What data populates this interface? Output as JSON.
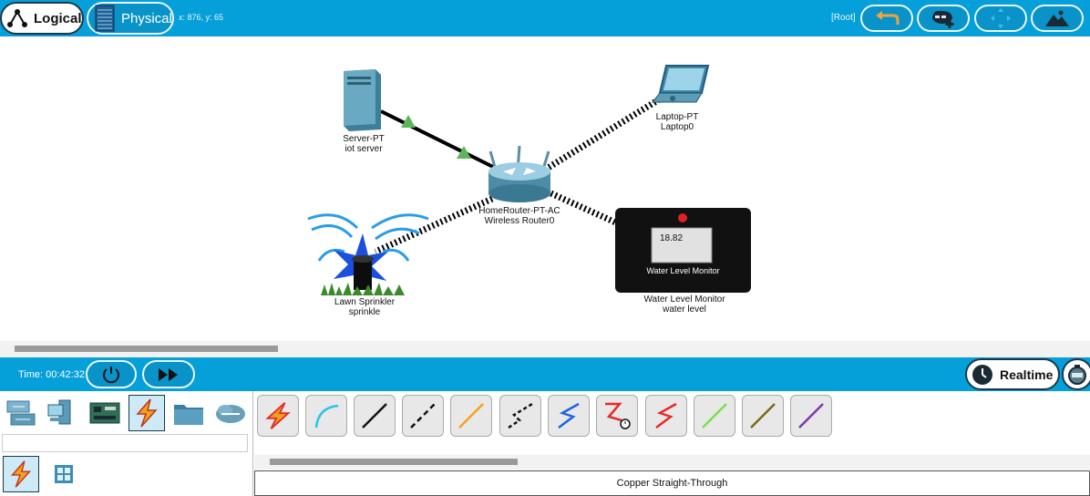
{
  "topbar": {
    "logical_label": "Logical",
    "physical_label": "Physical",
    "coords": "x: 876, y: 65",
    "root_label": "[Root]"
  },
  "devices": {
    "server": {
      "model": "Server-PT",
      "name": "iot server"
    },
    "laptop": {
      "model": "Laptop-PT",
      "name": "Laptop0"
    },
    "router": {
      "model": "HomeRouter-PT-AC",
      "name": "Wireless Router0"
    },
    "sprinkler": {
      "model": "Lawn Sprinkler",
      "name": "sprinkle"
    },
    "monitor": {
      "model": "Water Level Monitor",
      "name": "water  level",
      "reading": "18.82",
      "screen_title": "Water Level Monitor"
    }
  },
  "timebar": {
    "time_label": "Time: 00:42:32",
    "realtime_label": "Realtime"
  },
  "device_categories": [
    {
      "icon": "network-devices-icon"
    },
    {
      "icon": "end-devices-icon"
    },
    {
      "icon": "components-icon"
    },
    {
      "icon": "connections-icon",
      "selected": true
    },
    {
      "icon": "miscellaneous-icon"
    },
    {
      "icon": "multiuser-icon"
    }
  ],
  "subcategories": [
    {
      "icon": "connections-sub-icon",
      "selected": true
    },
    {
      "icon": "structured-cabling-icon"
    }
  ],
  "connections": [
    {
      "icon": "automatic-connection-icon",
      "color": "#e52b2b"
    },
    {
      "icon": "console-cable-icon",
      "color": "#27c4e8"
    },
    {
      "icon": "copper-straight-through-icon",
      "color": "#111111"
    },
    {
      "icon": "copper-cross-over-icon",
      "color": "#111111"
    },
    {
      "icon": "fiber-icon",
      "color": "#f4a21c"
    },
    {
      "icon": "phone-cable-icon",
      "color": "#111111"
    },
    {
      "icon": "coaxial-icon",
      "color": "#1e63e6"
    },
    {
      "icon": "serial-dce-icon",
      "color": "#e52b2b"
    },
    {
      "icon": "serial-dte-icon",
      "color": "#e52b2b"
    },
    {
      "icon": "octal-cable-icon",
      "color": "#7ae04c"
    },
    {
      "icon": "iot-custom-cable-icon",
      "color": "#7b6a16"
    },
    {
      "icon": "usb-cable-icon",
      "color": "#7a3aab"
    }
  ],
  "connection_description": "Copper Straight-Through",
  "colors": {
    "bar_blue": "#059fd9",
    "link_green": "#5fb55a"
  }
}
